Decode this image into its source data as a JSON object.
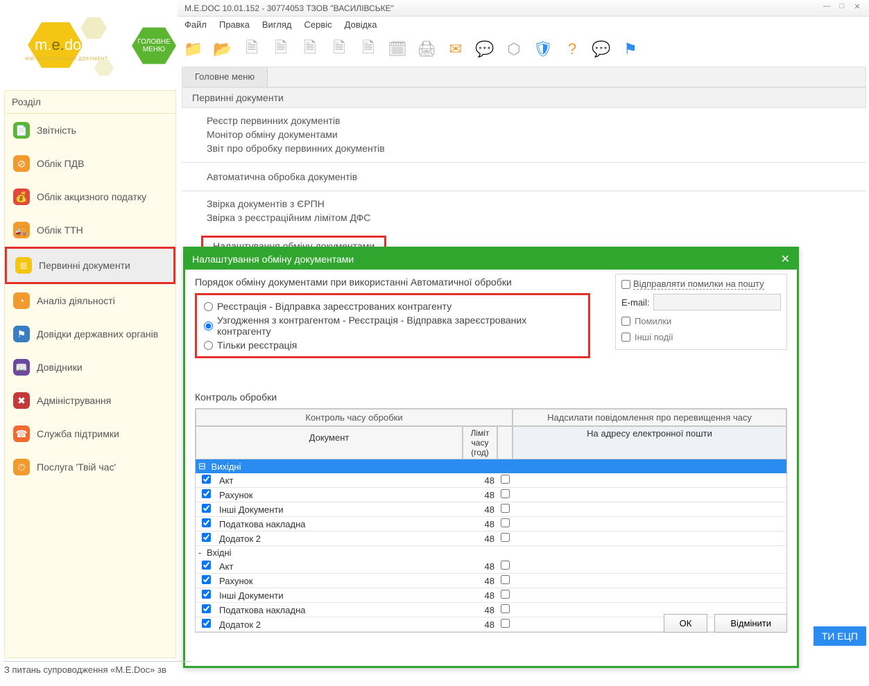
{
  "window": {
    "title": "M.E.DOC 10.01.152  - 30774053 ТЗОВ \"ВАСИЛІВСЬКЕ\""
  },
  "logo": {
    "brand_left": "m.",
    "brand_mid": "e.",
    "brand_right": "doc",
    "sub": "МІЙ ЕЛЕКТРОННИЙ ДОКУМЕНТ"
  },
  "main_menu_hex": "ГОЛОВНЕ МЕНЮ",
  "menubar": {
    "file": "Файл",
    "edit": "Правка",
    "view": "Вигляд",
    "service": "Сервіс",
    "help": "Довідка"
  },
  "tabs": {
    "main": "Головне меню"
  },
  "sidebar": {
    "title": "Розділ",
    "items": [
      {
        "label": "Звітність",
        "color": "#5cb531",
        "glyph": "📄"
      },
      {
        "label": "Облік ПДВ",
        "color": "#f29a2e",
        "glyph": "⊘"
      },
      {
        "label": "Облік акцизного податку",
        "color": "#e14a3b",
        "glyph": "💰"
      },
      {
        "label": "Облік ТТН",
        "color": "#f29a2e",
        "glyph": "🚚"
      },
      {
        "label": "Первинні документи",
        "color": "#f4c613",
        "glyph": "≣",
        "selected": true
      },
      {
        "label": "Аналіз діяльності",
        "color": "#f29a2e",
        "glyph": "◔"
      },
      {
        "label": "Довідки державних органів",
        "color": "#3a7ec2",
        "glyph": "⚑"
      },
      {
        "label": "Довідники",
        "color": "#6a4aa0",
        "glyph": "📖"
      },
      {
        "label": "Адміністрування",
        "color": "#c43a3a",
        "glyph": "✖"
      },
      {
        "label": "Служба підтримки",
        "color": "#f26a2e",
        "glyph": "☎"
      },
      {
        "label": "Послуга 'Твій час'",
        "color": "#f29a2e",
        "glyph": "⏱"
      }
    ]
  },
  "content": {
    "header": "Первинні документи",
    "group1": [
      "Реєстр первинних документів",
      "Монітор обміну документами",
      "Звіт про обробку первинних документів"
    ],
    "group2": [
      "Автоматична обробка документів"
    ],
    "group3": [
      "Звірка документів з ЄРПН",
      "Звірка з реєстраційним лімітом ДФС"
    ],
    "highlighted_link": "Налаштування обміну документами"
  },
  "dialog": {
    "title": "Налаштування обміну документами",
    "order_label": "Порядок обміну документами при використанні Автоматичної обробки",
    "radios": [
      "Реєстрація - Відправка зареєстрованих контрагенту",
      "Узгодження з контрагентом - Реєстрація - Відправка зареєстрованих контрагенту",
      "Тільки реєстрація"
    ],
    "selected_radio": 1,
    "email_panel": {
      "send_errors": "Відправляти помилки на пошту",
      "email_label": "E-mail:",
      "errors": "Помилки",
      "other": "Інші події"
    },
    "control_label": "Контроль обробки",
    "grid_header": {
      "left": "Контроль часу обробки",
      "right": "Надсилати повідомлення про перевищення часу",
      "doc": "Документ",
      "limit": "Ліміт часу (год)",
      "mail": "На адресу електронної пошти"
    },
    "groups": [
      {
        "name": "Вихідні",
        "expanded": true,
        "hl": true,
        "rows": [
          {
            "name": "Акт",
            "limit": 48
          },
          {
            "name": "Рахунок",
            "limit": 48
          },
          {
            "name": "Інші Документи",
            "limit": 48
          },
          {
            "name": "Податкова накладна",
            "limit": 48
          },
          {
            "name": "Додаток 2",
            "limit": 48
          }
        ]
      },
      {
        "name": "Вхідні",
        "expanded": true,
        "hl": false,
        "rows": [
          {
            "name": "Акт",
            "limit": 48
          },
          {
            "name": "Рахунок",
            "limit": 48
          },
          {
            "name": "Інші Документи",
            "limit": 48
          },
          {
            "name": "Податкова накладна",
            "limit": 48
          },
          {
            "name": "Додаток 2",
            "limit": 48
          }
        ]
      }
    ],
    "ok": "ОК",
    "cancel": "Відмінити"
  },
  "footer": {
    "support": "З питань супроводження «M.E.Doc» зв",
    "ecp": "ТИ ЕЦП"
  }
}
